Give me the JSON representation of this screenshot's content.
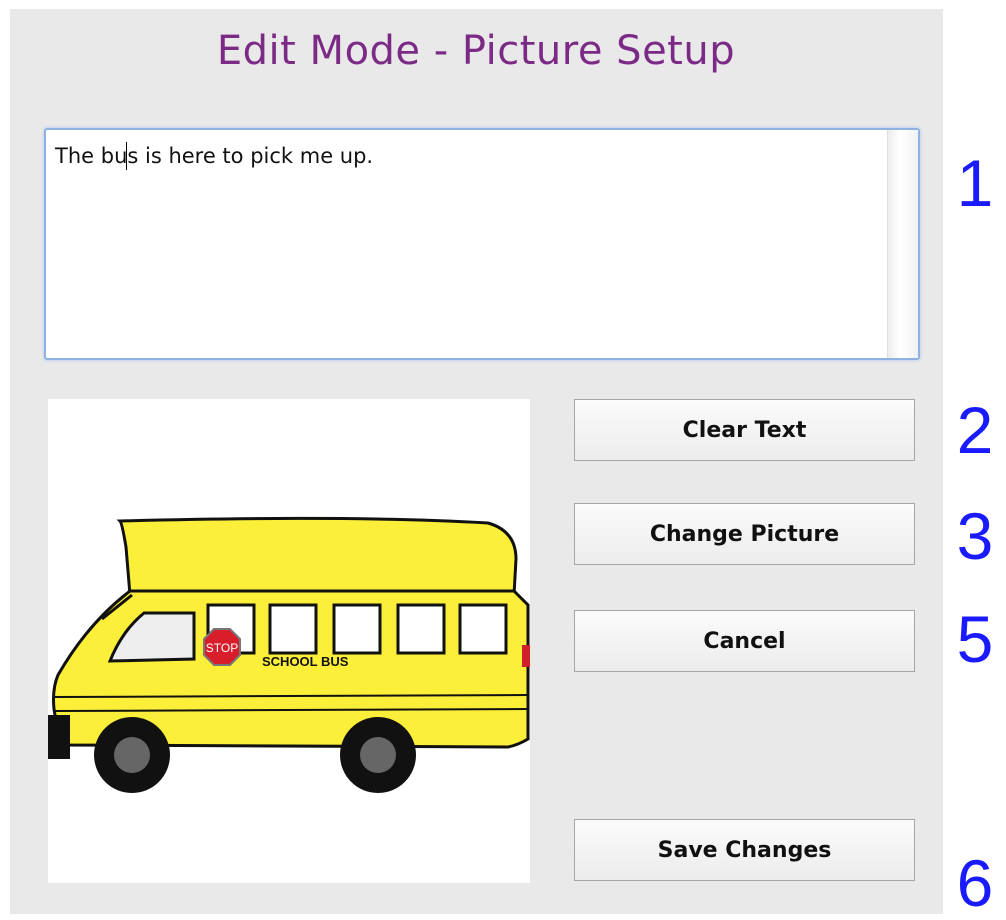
{
  "window": {
    "title": "Edit Mode - Picture Setup"
  },
  "editor": {
    "text": "The bus is here to pick me up."
  },
  "picture": {
    "sign_text": "STOP",
    "bus_text": "SCHOOL BUS"
  },
  "buttons": {
    "clear_text": "Clear Text",
    "change_picture": "Change Picture",
    "cancel": "Cancel",
    "save_changes": "Save Changes"
  },
  "markers": [
    "1",
    "2",
    "3",
    "5",
    "6"
  ],
  "colors": {
    "title": "#7b2a86",
    "marker": "#1a1aff",
    "bus": "#fbef3a",
    "panel": "#e9e9e9"
  }
}
